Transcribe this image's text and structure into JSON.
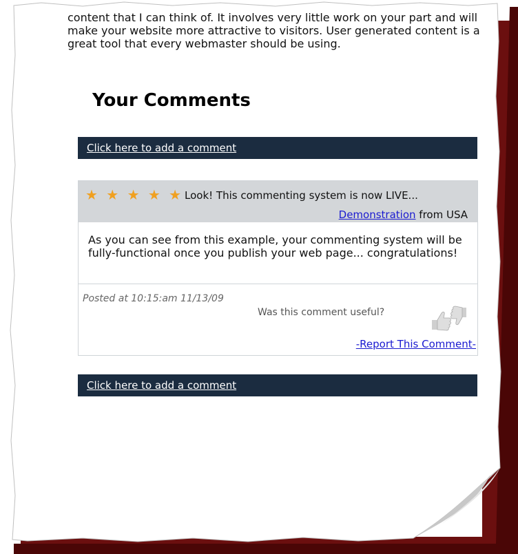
{
  "intro": {
    "text": "content that I can think of. It involves very little work on your part and will make your website more attractive to visitors. User generated content is a great tool that every webmaster should be using."
  },
  "comments": {
    "heading": "Your Comments",
    "add_comment_top": "Click here to add a comment",
    "add_comment_bottom": "Click here to add a comment",
    "entry": {
      "stars": "★ ★ ★ ★ ★",
      "rating": 5,
      "title": "Look! This commenting system is now LIVE...",
      "author_link": "Demonstration",
      "author_suffix": " from USA",
      "body": "As you can see from this example, your commenting system will be fully-functional once you publish your web page... congratulations!",
      "posted": "Posted at 10:15:am 11/13/09",
      "useful_prompt": "Was this comment useful?",
      "report_link": "-Report This Comment-"
    }
  },
  "colors": {
    "bar": "#1b2c40",
    "star": "#f0a020",
    "link": "#1a1ad0",
    "page_shadow": "#6b0f0f"
  }
}
